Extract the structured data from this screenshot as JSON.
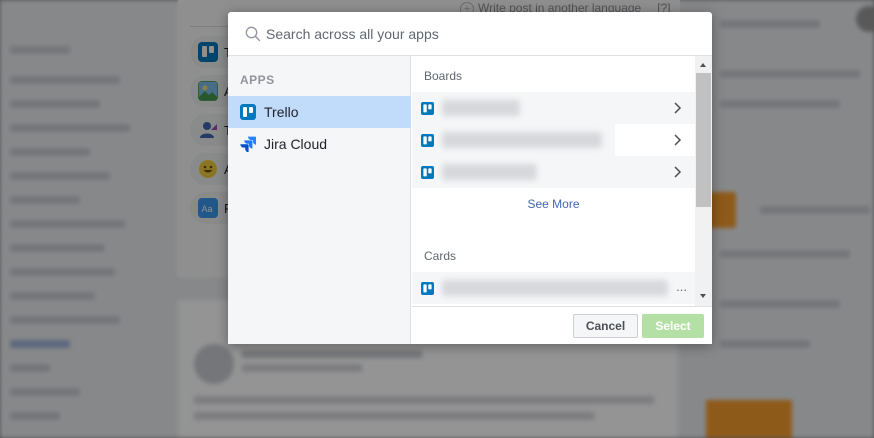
{
  "background": {
    "composer_language_link": "Write post in another language",
    "composer_help": "[?]",
    "composer_options": [
      {
        "initial": "T",
        "icon": "trello-icon"
      },
      {
        "initial": "A",
        "icon": "photo-icon"
      },
      {
        "initial": "T",
        "icon": "tag-people-icon"
      },
      {
        "initial": "A",
        "icon": "smiley-icon"
      },
      {
        "initial": "F",
        "icon": "text-format-icon"
      }
    ]
  },
  "dialog": {
    "search": {
      "placeholder": "Search across all your apps"
    },
    "apps_pane": {
      "heading": "APPS",
      "items": [
        {
          "label": "Trello",
          "icon": "trello-icon",
          "selected": true
        },
        {
          "label": "Jira Cloud",
          "icon": "jira-icon",
          "selected": false
        }
      ]
    },
    "results": {
      "boards_title": "Boards",
      "board_rows": 3,
      "see_more": "See More",
      "cards_title": "Cards",
      "card_ellipsis": "..."
    },
    "footer": {
      "cancel_label": "Cancel",
      "select_label": "Select"
    }
  },
  "colors": {
    "selected_app_bg": "#c1dbfb",
    "trello_blue": "#0079bf",
    "jira_blue": "#2684ff",
    "link_blue": "#4267b2",
    "select_disabled_green": "#b5e0a5"
  }
}
